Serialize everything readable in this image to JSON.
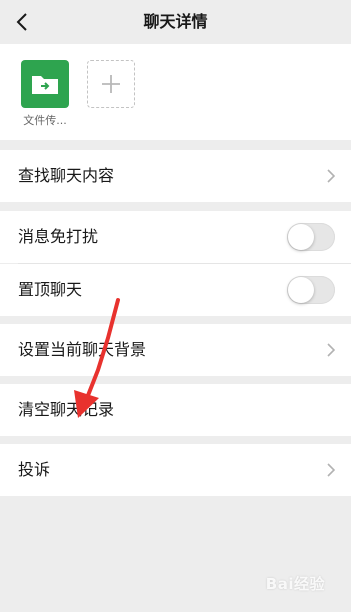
{
  "header": {
    "title": "聊天详情",
    "back_icon": "chevron-left-icon"
  },
  "members": {
    "items": [
      {
        "name": "文件传...",
        "icon": "file-transfer-icon",
        "color": "#2ea44f"
      }
    ],
    "add_icon": "plus-icon"
  },
  "settings": {
    "search_chat": "查找聊天内容",
    "mute": {
      "label": "消息免打扰",
      "on": false
    },
    "pin": {
      "label": "置顶聊天",
      "on": false
    },
    "background": "设置当前聊天背景",
    "clear_history": "清空聊天记录",
    "complain": "投诉"
  },
  "annotation": {
    "arrow_color": "#e8322e"
  },
  "watermark": "Bai经验"
}
